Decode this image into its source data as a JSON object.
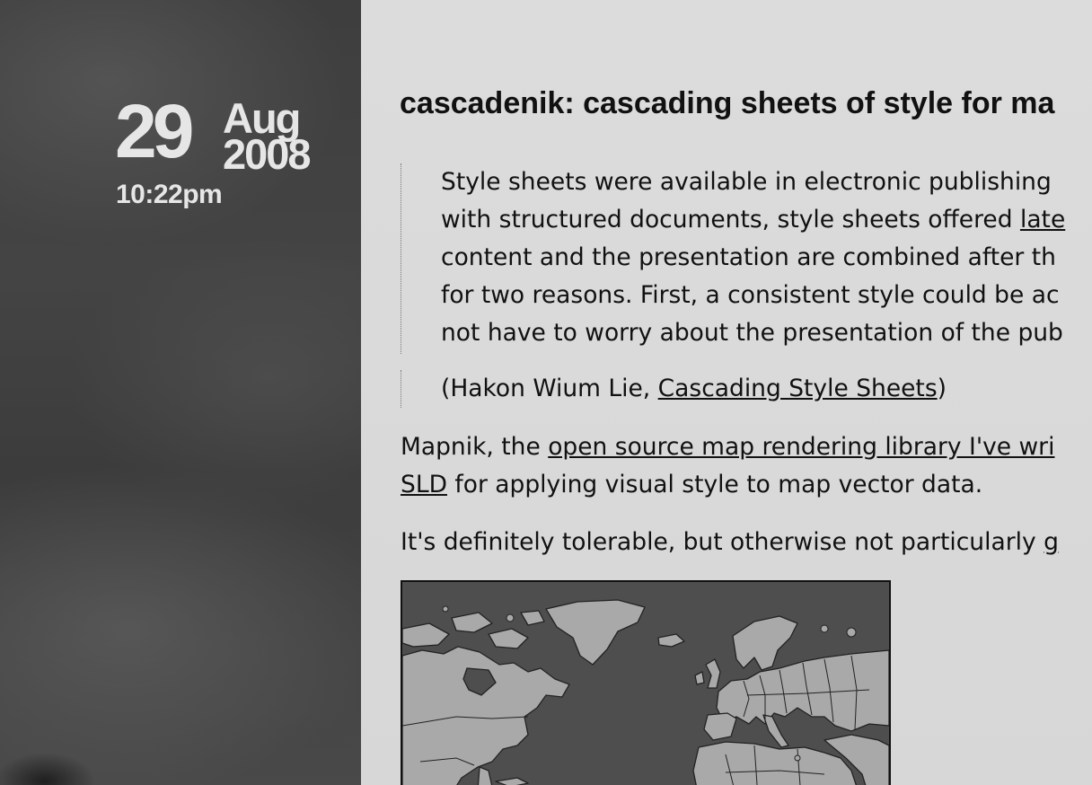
{
  "date": {
    "day": "29",
    "month": "Aug",
    "year": "2008",
    "time": "10:22pm"
  },
  "post": {
    "title": "cascadenik: cascading sheets of style for ma",
    "quote_lines": [
      "Style sheets were available in electronic publishing",
      "with structured documents, style sheets offered ",
      "content and the presentation are combined after th",
      "for two reasons. First, a consistent style could be ac",
      "not have to worry about the presentation of the pub"
    ],
    "quote_line2_link": "late",
    "citation_prefix": "(Hakon Wium Lie, ",
    "citation_link": "Cascading Style Sheets",
    "citation_suffix": ")",
    "para1_prefix": "Mapnik, the ",
    "para1_link": "open source map rendering library I've wri",
    "para1_line2_link": "SLD",
    "para1_line2_text": " for applying visual style to map vector data.",
    "para2_text": "It's definitely tolerable, but otherwise not particularly ",
    "para2_trailing": "g"
  },
  "colors": {
    "sidebar": "#404040",
    "content_bg": "#d9d9d9",
    "text": "#111111",
    "map_water": "#4e4e4e",
    "map_land": "#a8a8a8"
  }
}
